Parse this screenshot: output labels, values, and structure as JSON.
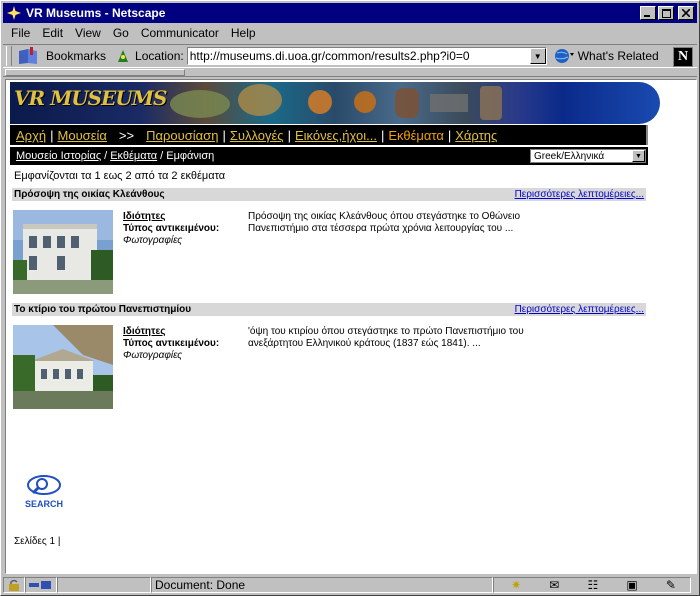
{
  "window": {
    "title": "VR Museums - Netscape"
  },
  "menu": [
    "File",
    "Edit",
    "View",
    "Go",
    "Communicator",
    "Help"
  ],
  "toolbar": {
    "bookmarks_label": "Bookmarks",
    "location_label": "Location:",
    "url": "http://museums.di.uoa.gr/common/results2.php?i0=0",
    "whats_related": "What's Related"
  },
  "banner": {
    "logo_text": "VR MUSEUMS"
  },
  "nav": {
    "items": [
      "Αρχή",
      "Μουσεία",
      ">>",
      "Παρουσίαση",
      "Συλλογές",
      "Εικόνες,ήχοι...",
      "Εκθέματα",
      "Χάρτης"
    ]
  },
  "breadcrumb": {
    "museum": "Μουσείο Ιστορίας",
    "section": "Εκθέματα",
    "current": "Εμφάνιση",
    "sep": "/"
  },
  "language": {
    "selected": "Greek/Ελληνικά"
  },
  "results": {
    "summary": "Εμφανίζονται τα 1 εως 2 από τα 2 εκθέματα",
    "more_label": "Περισσότερες λεπτομέρειες...",
    "items": [
      {
        "title": "Πρόσοψη της οικίας Κλεάνθους",
        "prop_label": "Ιδιότητες",
        "type_label": "Τύπος αντικειμένου:",
        "type_value": "Φωτογραφίες",
        "desc_line1": "Πρόσοψη της οικίας Κλεάνθους όπου στεγάστηκε το Οθώνειο",
        "desc_line2": "Πανεπιστήμιο στα τέσσερα πρώτα χρόνια λειτουργίας του ..."
      },
      {
        "title": "Το κτίριο του πρώτου Πανεπιστημίου",
        "prop_label": "Ιδιότητες",
        "type_label": "Τύπος αντικειμένου:",
        "type_value": "Φωτογραφίες",
        "desc_line1": "'όψη του κτιρίου όπου στεγάστηκε το πρώτο Πανεπιστήμιο του",
        "desc_line2": "ανεξάρτητου Ελληνικού κράτους (1837 εώς 1841). ..."
      }
    ]
  },
  "search_label": "SEARCH",
  "pages": "Σελίδες 1 |",
  "status": {
    "text": "Document: Done"
  },
  "colors": {
    "titlebar": "#000080",
    "nav_link": "#e0c040",
    "nav_current": "#f0a000",
    "more_link": "#0000cc"
  }
}
